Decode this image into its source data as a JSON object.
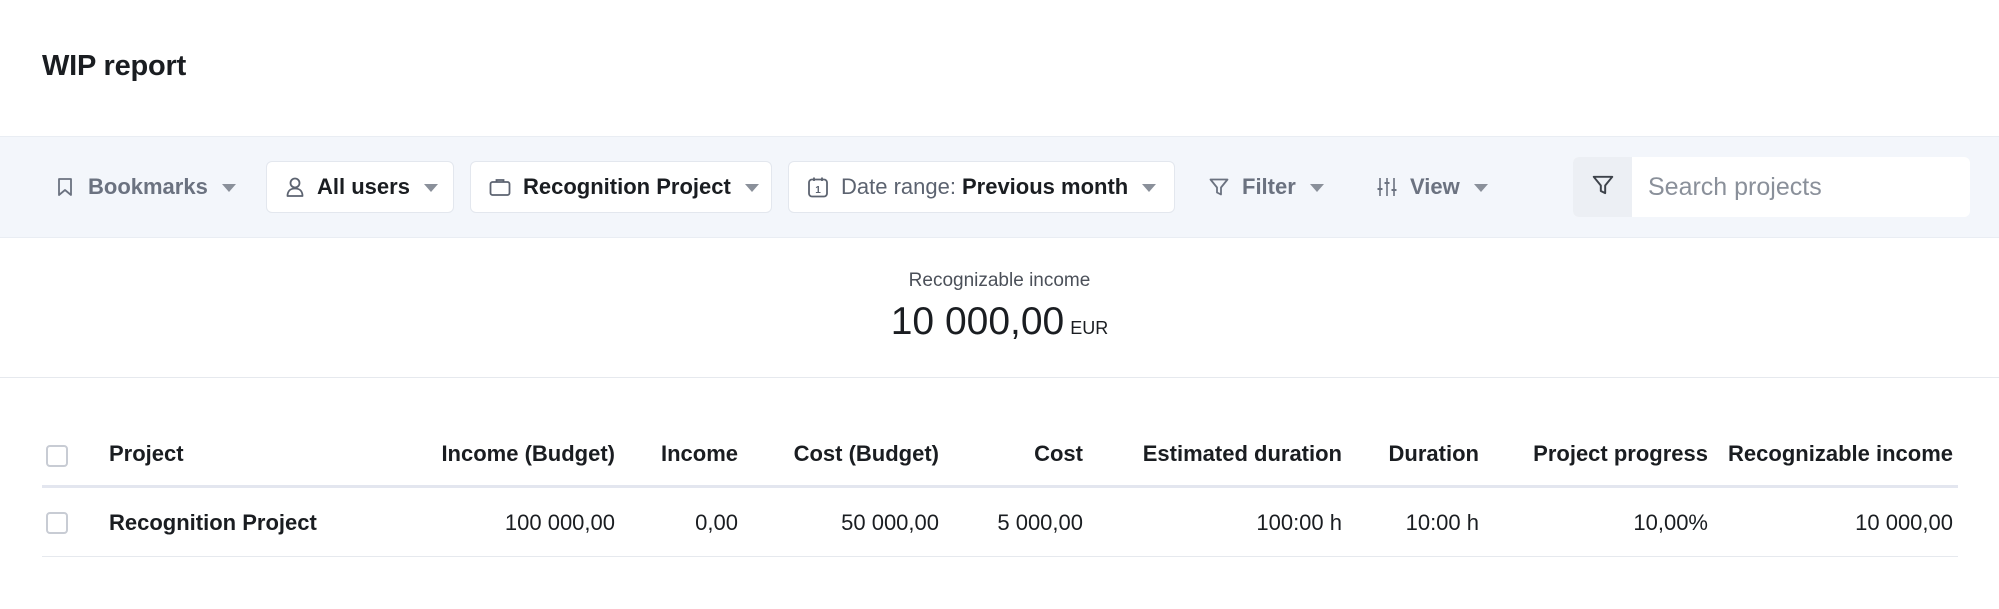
{
  "page": {
    "title": "WIP report"
  },
  "toolbar": {
    "bookmarks": "Bookmarks",
    "users": "All users",
    "project": "Recognition Project",
    "date_prefix": "Date range:",
    "date_value": "Previous month",
    "filter": "Filter",
    "view": "View",
    "search_placeholder": "Search projects"
  },
  "summary": {
    "label": "Recognizable income",
    "value": "10 000,00",
    "currency": "EUR"
  },
  "table": {
    "headers": {
      "project": "Project",
      "income_budget": "Income (Budget)",
      "income": "Income",
      "cost_budget": "Cost (Budget)",
      "cost": "Cost",
      "estimated_duration": "Estimated duration",
      "duration": "Duration",
      "progress": "Project progress",
      "recognizable_income": "Recognizable income"
    },
    "rows": [
      {
        "project": "Recognition Project",
        "income_budget": "100 000,00",
        "income": "0,00",
        "cost_budget": "50 000,00",
        "cost": "5 000,00",
        "estimated_duration": "100:00 h",
        "duration": "10:00 h",
        "progress": "10,00%",
        "recognizable_income": "10 000,00"
      }
    ]
  }
}
